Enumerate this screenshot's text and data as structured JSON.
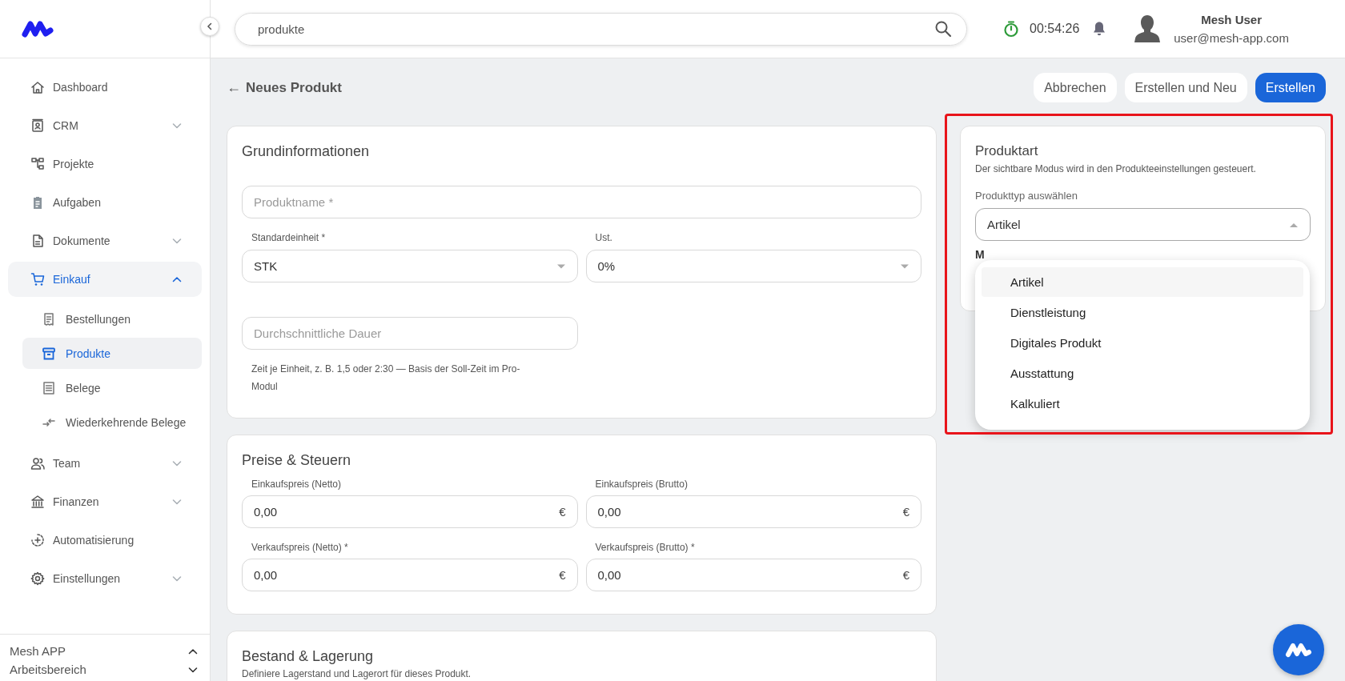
{
  "sidebar": {
    "items": [
      {
        "label": "Dashboard",
        "selected": false
      },
      {
        "label": "CRM",
        "selected": false,
        "expanded": false
      },
      {
        "label": "Projekte",
        "selected": false
      },
      {
        "label": "Aufgaben",
        "selected": false
      },
      {
        "label": "Dokumente",
        "selected": false,
        "expanded": false
      },
      {
        "label": "Einkauf",
        "selected": true,
        "expanded": true,
        "children": [
          {
            "label": "Bestellungen",
            "selected": false
          },
          {
            "label": "Produkte",
            "selected": true
          },
          {
            "label": "Belege",
            "selected": false
          },
          {
            "label": "Wiederkehrende Belege",
            "selected": false
          }
        ]
      },
      {
        "label": "Team",
        "selected": false,
        "expanded": false
      },
      {
        "label": "Finanzen",
        "selected": false,
        "expanded": false
      },
      {
        "label": "Automatisierung",
        "selected": false
      },
      {
        "label": "Einstellungen",
        "selected": false,
        "expanded": false
      }
    ],
    "footer": {
      "app": "Mesh APP",
      "workspace": "Arbeitsbereich"
    }
  },
  "header": {
    "search": {
      "value": "produkte"
    },
    "timer": "00:54:26",
    "user": {
      "name": "Mesh User",
      "email": "user@mesh-app.com"
    }
  },
  "page": {
    "back": "←",
    "title": "Neues Produkt",
    "buttons": [
      {
        "label": "Abbrechen",
        "primary": false
      },
      {
        "label": "Erstellen und Neu",
        "primary": false
      },
      {
        "label": "Erstellen",
        "primary": true
      }
    ]
  },
  "basic_info": {
    "title": "Grundinformationen",
    "name_field": {
      "placeholder": "Produktname *"
    },
    "unit": {
      "label": "Standardeinheit *",
      "value": "STK",
      "open": false
    },
    "vat": {
      "label": "Ust.",
      "value": "0%",
      "open": false
    },
    "duration_field": {
      "placeholder": "Durchschnittliche Dauer",
      "help": "Zeit je Einheit, z. B. 1,5 oder 2:30 — Basis der Soll-Zeit im Pro-Modul"
    }
  },
  "prices": {
    "title": "Preise & Steuern",
    "fields": [
      {
        "label": "Einkaufspreis (Netto)",
        "value": "0,00",
        "currency": "€"
      },
      {
        "label": "Einkaufspreis (Brutto)",
        "value": "0,00",
        "currency": "€"
      },
      {
        "label": "Verkaufspreis (Netto) *",
        "value": "0,00",
        "currency": "€"
      },
      {
        "label": "Verkaufspreis (Brutto) *",
        "value": "0,00",
        "currency": "€"
      }
    ]
  },
  "stock": {
    "title": "Bestand & Lagerung",
    "description": "Definiere Lagerstand und Lagerort für dieses Produkt."
  },
  "product_type": {
    "title": "Produktart",
    "description": "Der sichtbare Modus wird in den Produkteeinstellungen gesteuert.",
    "select": {
      "label": "Produkttyp auswählen",
      "value": "Artikel",
      "open": true
    },
    "next_label": "M",
    "menu": [
      {
        "label": "Artikel",
        "selected": true
      },
      {
        "label": "Dienstleistung",
        "selected": false
      },
      {
        "label": "Digitales Produkt",
        "selected": false
      },
      {
        "label": "Ausstattung",
        "selected": false
      },
      {
        "label": "Kalkuliert",
        "selected": false
      }
    ]
  }
}
